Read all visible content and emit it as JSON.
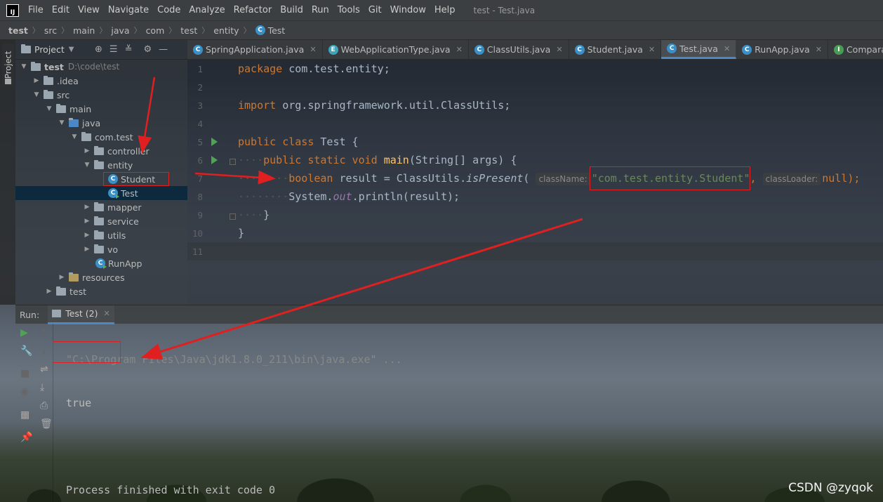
{
  "menubar": {
    "logo": "IJ",
    "items": [
      "File",
      "Edit",
      "View",
      "Navigate",
      "Code",
      "Analyze",
      "Refactor",
      "Build",
      "Run",
      "Tools",
      "Git",
      "Window",
      "Help"
    ],
    "window_title": "test - Test.java"
  },
  "breadcrumb": [
    "test",
    "src",
    "main",
    "java",
    "com",
    "test",
    "entity",
    "Test"
  ],
  "sidebar": {
    "tab_label": "Project"
  },
  "project": {
    "header_label": "Project",
    "root_name": "test",
    "root_path": "D:\\code\\test",
    "items": {
      "idea": ".idea",
      "src": "src",
      "main": "main",
      "java": "java",
      "comtest": "com.test",
      "controller": "controller",
      "entity": "entity",
      "student": "Student",
      "test_class": "Test",
      "mapper": "mapper",
      "service": "service",
      "utils": "utils",
      "vo": "vo",
      "runapp": "RunApp",
      "resources": "resources",
      "test_dir": "test"
    }
  },
  "tabs": [
    {
      "label": "SpringApplication.java",
      "icon": "c"
    },
    {
      "label": "WebApplicationType.java",
      "icon": "e"
    },
    {
      "label": "ClassUtils.java",
      "icon": "c"
    },
    {
      "label": "Student.java",
      "icon": "c"
    },
    {
      "label": "Test.java",
      "icon": "c"
    },
    {
      "label": "RunApp.java",
      "icon": "c"
    },
    {
      "label": "Comparator.class",
      "icon": "i"
    }
  ],
  "editor": {
    "line_numbers": [
      "1",
      "2",
      "3",
      "4",
      "5",
      "6",
      "7",
      "8",
      "9",
      "10",
      "11"
    ],
    "l1_kw": "package",
    "l1_rest": " com.test.entity;",
    "l3_kw": "import",
    "l3_rest": " org.springframework.util.ClassUtils;",
    "l5_kw": "public class",
    "l5_rest": " Test {",
    "l6_kw": "public static void",
    "l6_fn": "main",
    "l6_rest": "(String[] args) {",
    "l7_kw": "boolean",
    "l7_a": " result = ClassUtils.",
    "l7_method": "isPresent",
    "l7_paren": "(",
    "l7_hint1": "className:",
    "l7_string": "\"com.test.entity.Student\"",
    "l7_comma": ",",
    "l7_hint2": "classLoader:",
    "l7_null": "null",
    "l7_end": ");",
    "l8_a": "System.",
    "l8_out": "out",
    "l8_rest": ".println(result);",
    "l9": "}",
    "l10": "}"
  },
  "run": {
    "label": "Run:",
    "tab": "Test (2)",
    "console": {
      "cmd": "\"C:\\Program Files\\Java\\jdk1.8.0_211\\bin\\java.exe\" ...",
      "result": "true",
      "finish": "Process finished with exit code 0"
    }
  },
  "watermark": "CSDN @zyqok",
  "colors": {
    "keyword": "#cc7832",
    "string": "#6a8759",
    "method": "#ffc66d",
    "annotation": "#e02020",
    "selection": "#0d293e"
  }
}
